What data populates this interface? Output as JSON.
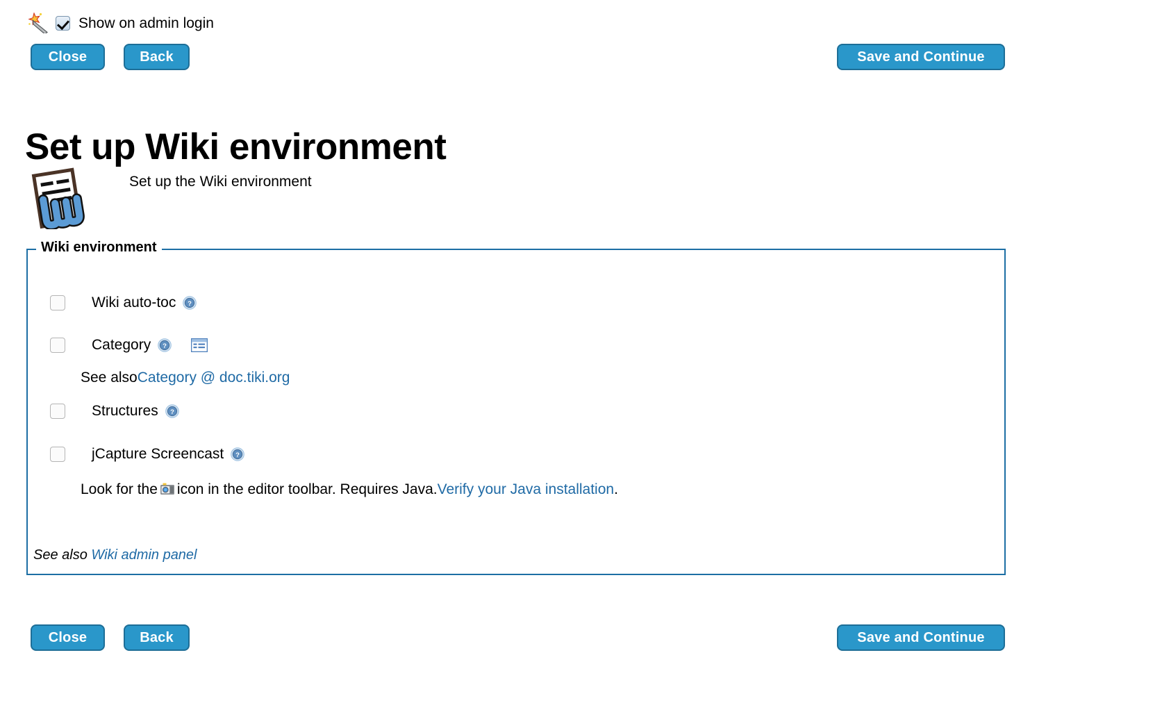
{
  "header": {
    "wand_icon": "magic-wand-icon",
    "admin_checkbox_label": "Show on admin login",
    "admin_checkbox_checked": true
  },
  "toolbar_top": {
    "close_label": "Close",
    "back_label": "Back",
    "save_label": "Save and Continue"
  },
  "toolbar_bottom": {
    "close_label": "Close",
    "back_label": "Back",
    "save_label": "Save and Continue"
  },
  "page": {
    "title": "Set up Wiki environment",
    "intro_icon": "wiki-document-icon",
    "intro_text": "Set up the Wiki environment"
  },
  "fieldset": {
    "legend": "Wiki environment",
    "options": [
      {
        "label": "Wiki auto-toc",
        "checked": false,
        "help_icon": "help-icon"
      },
      {
        "label": "Category",
        "checked": false,
        "help_icon": "help-icon",
        "extra_icon": "list-settings-icon"
      },
      {
        "label": "Structures",
        "checked": false,
        "help_icon": "help-icon"
      },
      {
        "label": "jCapture Screencast",
        "checked": false,
        "help_icon": "help-icon"
      }
    ],
    "category_note_prefix": "See also ",
    "category_note_link": "Category @ doc.tiki.org",
    "jcapture_note_prefix": "Look for the ",
    "jcapture_note_icon": "camera-icon",
    "jcapture_note_middle": " icon in the editor toolbar. Requires Java. ",
    "jcapture_note_link": "Verify your Java installation",
    "jcapture_note_suffix": ".",
    "footer_prefix": "See also ",
    "footer_link": "Wiki admin panel"
  },
  "colors": {
    "button_fill": "#2a97ca",
    "button_border": "#1d6e97",
    "fieldset_border": "#1c6ea4",
    "link": "#1f6aa5",
    "text": "#000000",
    "background": "#ffffff"
  }
}
